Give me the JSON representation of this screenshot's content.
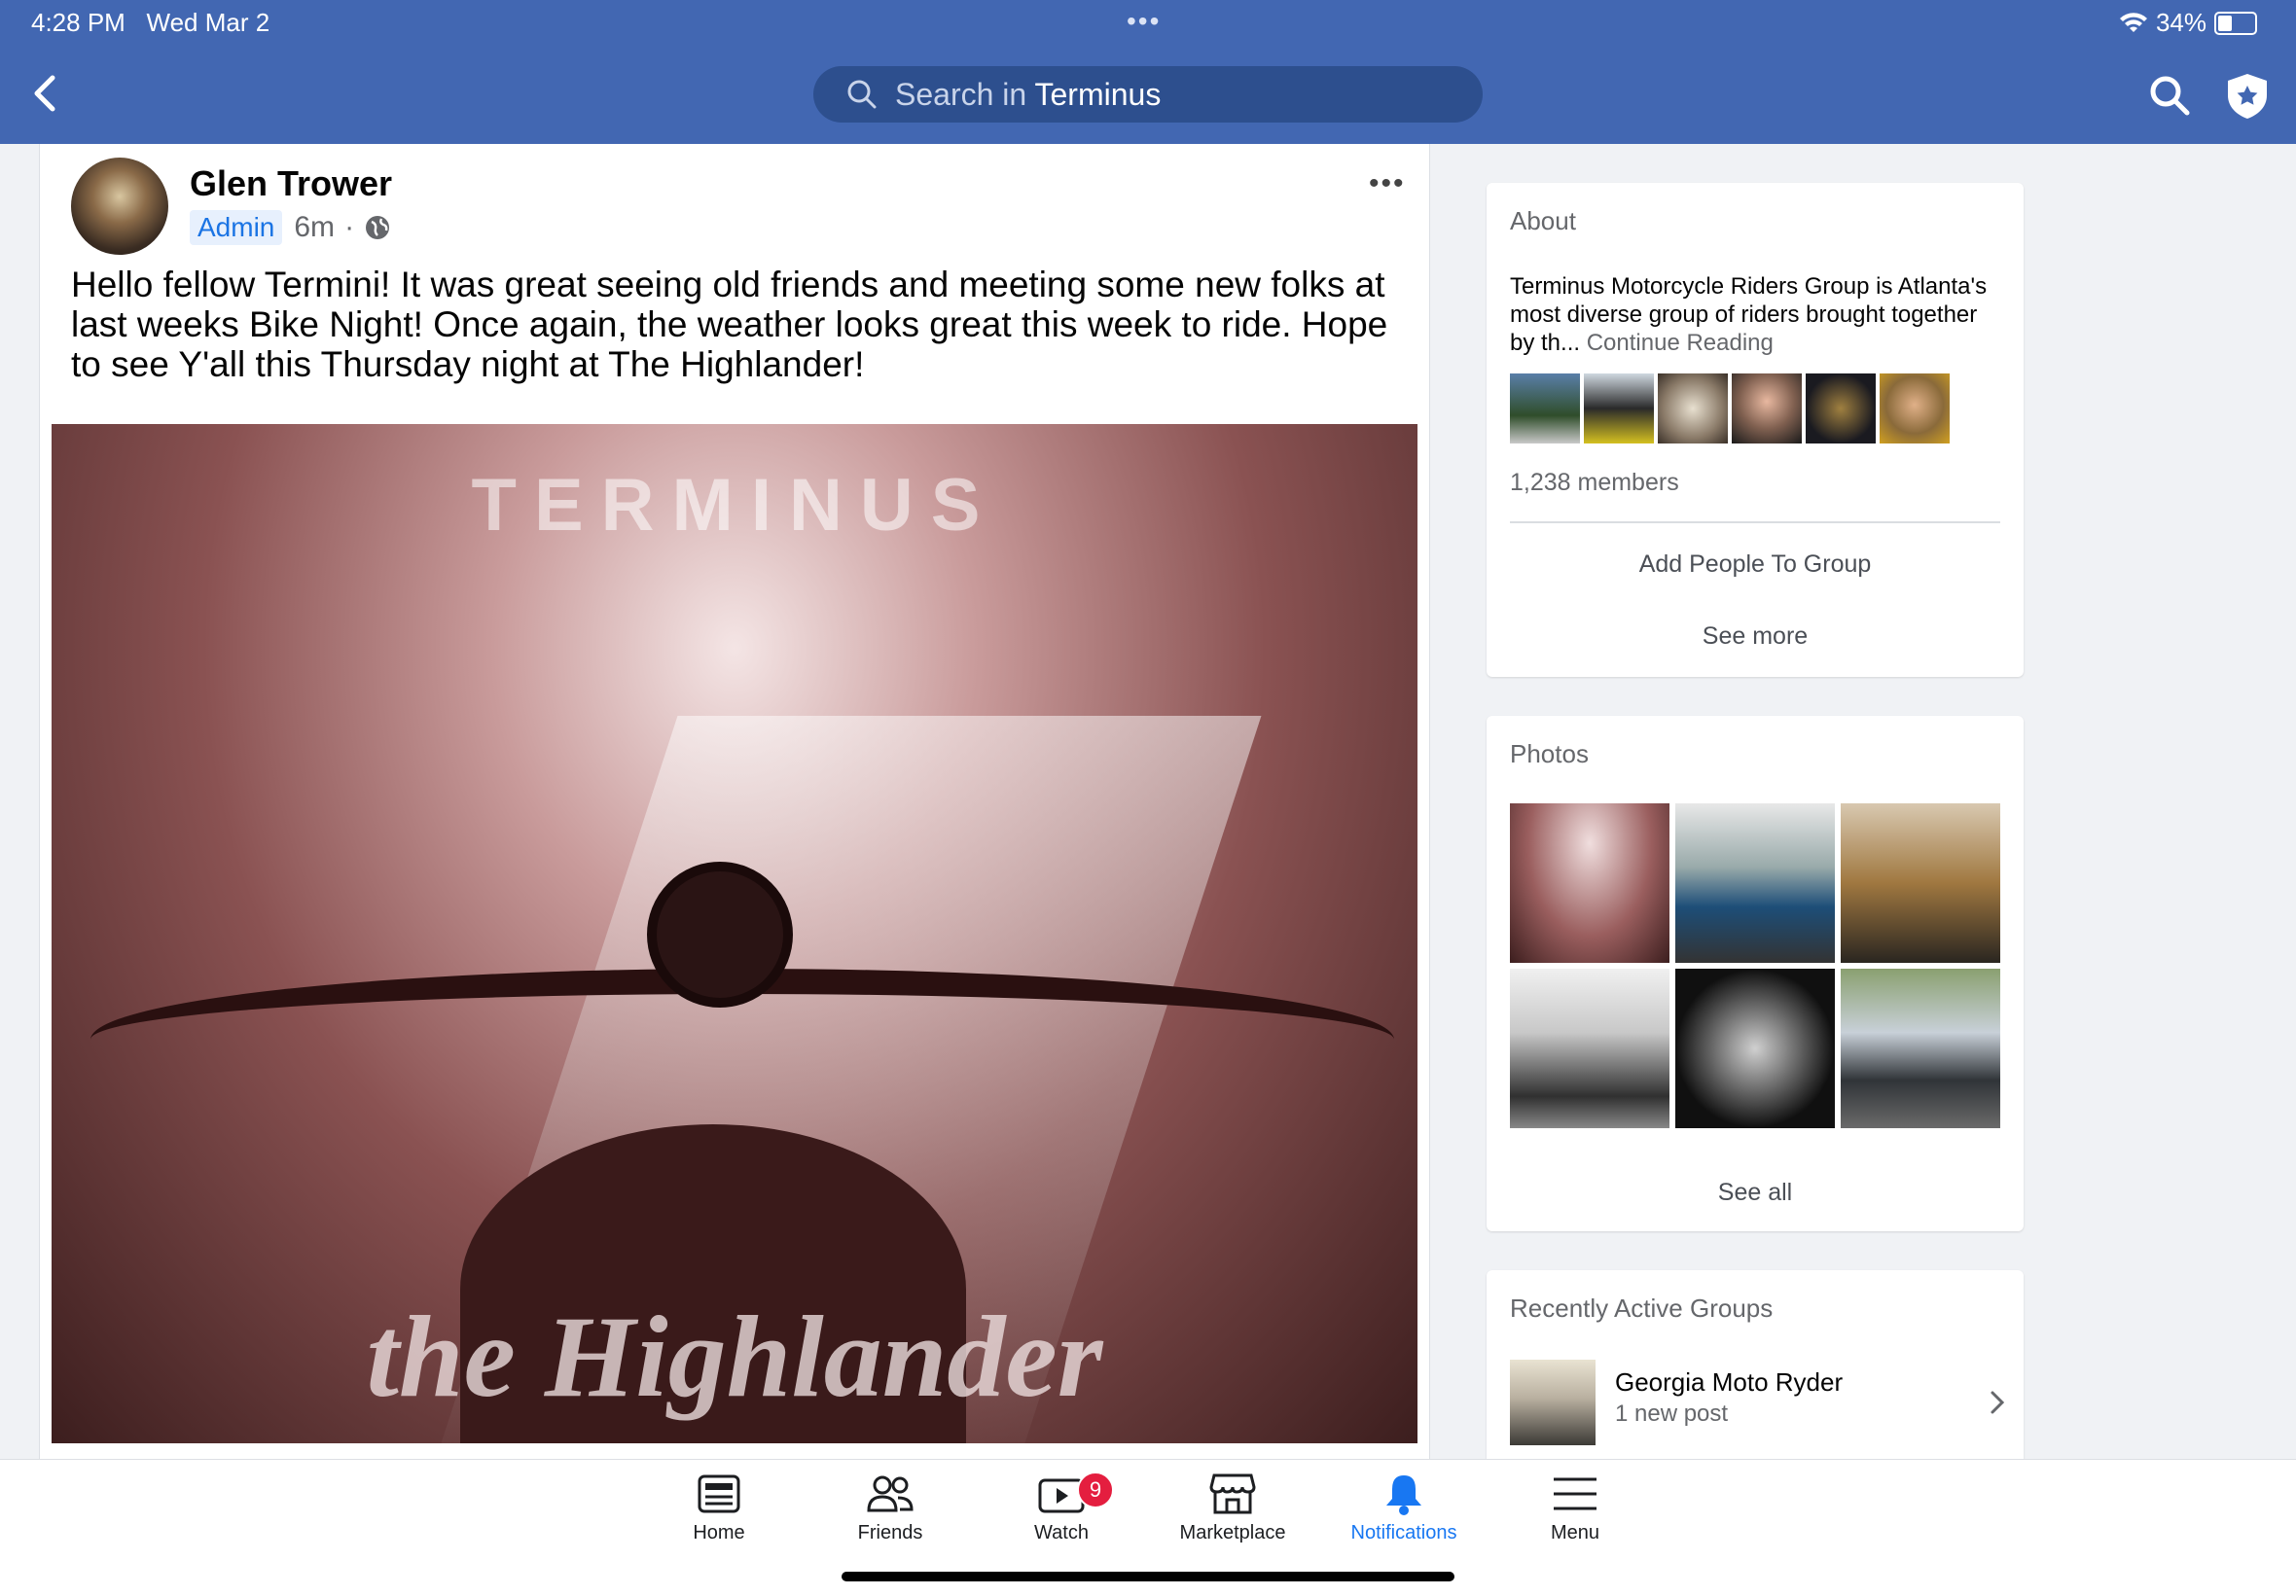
{
  "status_bar": {
    "time": "4:28 PM",
    "date": "Wed Mar 2",
    "battery": "34%",
    "battery_level": 0.34
  },
  "header": {
    "search_placeholder": "Search in",
    "search_group": "Terminus"
  },
  "post": {
    "author": "Glen Trower",
    "badge": "Admin",
    "time": "6m",
    "separator": "·",
    "text": "Hello fellow Termini! It was great seeing old friends and meeting some new folks at last weeks Bike Night! Once again, the weather looks great this week to ride. Hope to see Y'all this Thursday night at The Highlander!",
    "image_text_top": "TERMINUS",
    "image_text_bottom": "the Highlander"
  },
  "about": {
    "title": "About",
    "description": "Terminus Motorcycle Riders Group is Atlanta's most diverse group of riders brought together by th...",
    "continue": "Continue Reading",
    "members": "1,238 members",
    "add_people": "Add People To Group",
    "see_more": "See more"
  },
  "photos": {
    "title": "Photos",
    "see_all": "See all"
  },
  "recent_groups": {
    "title": "Recently Active Groups",
    "items": [
      {
        "name": "Georgia Moto Ryder",
        "subtitle": "1 new post"
      }
    ]
  },
  "tabbar": {
    "tabs": [
      {
        "label": "Home"
      },
      {
        "label": "Friends"
      },
      {
        "label": "Watch",
        "badge": "9"
      },
      {
        "label": "Marketplace"
      },
      {
        "label": "Notifications"
      },
      {
        "label": "Menu"
      }
    ],
    "active": "Notifications"
  },
  "colors": {
    "header_bg": "#4267b2",
    "active_tab": "#1877f2",
    "badge_red": "#e41e3f"
  }
}
